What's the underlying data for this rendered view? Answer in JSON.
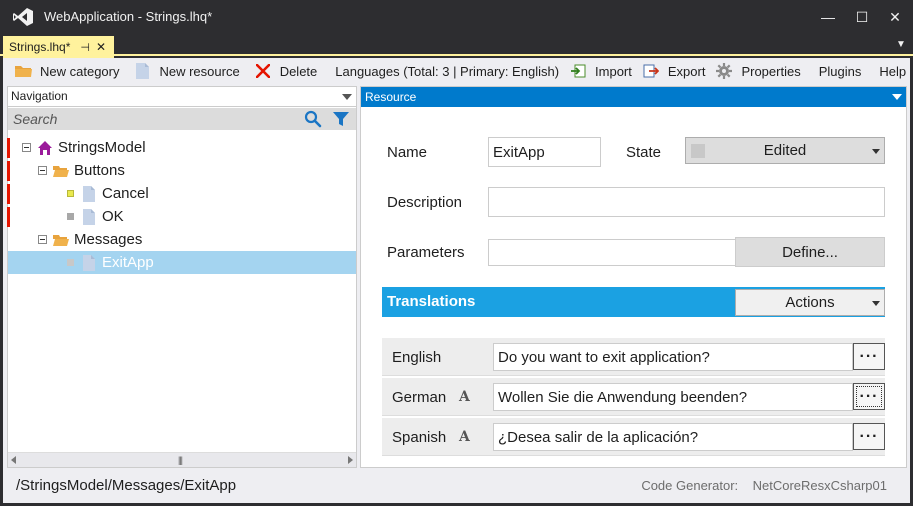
{
  "window": {
    "title": "WebApplication - Strings.lhq*",
    "minimize_glyph": "—",
    "maximize_glyph": "☐",
    "close_glyph": "✕"
  },
  "document_tab": {
    "label": "Strings.lhq*",
    "pin_glyph": "⊣",
    "close_glyph": "✕"
  },
  "toolbar": {
    "new_category": "New category",
    "new_resource": "New resource",
    "delete": "Delete",
    "languages": "Languages (Total: 3 | Primary: English)",
    "import": "Import",
    "export": "Export",
    "properties": "Properties",
    "plugins": "Plugins",
    "help": "Help"
  },
  "navigation": {
    "header": "Navigation",
    "search_placeholder": "Search",
    "tree": {
      "root": "StringsModel",
      "buttons": "Buttons",
      "cancel": "Cancel",
      "ok": "OK",
      "messages": "Messages",
      "exitapp": "ExitApp"
    }
  },
  "resource": {
    "header": "Resource",
    "name_label": "Name",
    "name_value": "ExitApp",
    "state_label": "State",
    "state_value": "Edited",
    "description_label": "Description",
    "description_value": "",
    "parameters_label": "Parameters",
    "parameters_value": "",
    "define_button": "Define...",
    "translations_label": "Translations",
    "actions_button": "Actions",
    "translations": [
      {
        "language": "English",
        "value": "Do you want to exit application?",
        "more": "···"
      },
      {
        "language": "German",
        "value": "Wollen Sie die Anwendung beenden?",
        "more": "···"
      },
      {
        "language": "Spanish",
        "value": "¿Desea salir de la aplicación?",
        "more": "···"
      }
    ],
    "auto_translate_glyph": "A"
  },
  "status": {
    "path": "/StringsModel/Messages/ExitApp",
    "code_generator": "Code Generator:    NetCoreResxCsharp01"
  },
  "colors": {
    "chrome": "#2d2d30",
    "tab_active": "#fff29d",
    "accent_blue": "#007acc",
    "translations_blue": "#1ba1e2",
    "selection": "#a4d4f0",
    "error_red": "#e51400",
    "state_new": "#e9e94e",
    "state_edited": "#a8a8a8"
  },
  "icons": {
    "app": "visual-studio-logo-icon",
    "new_category": "folder-icon",
    "new_resource": "document-icon",
    "delete": "red-x-icon",
    "import": "import-icon",
    "export": "export-icon",
    "properties": "gear-icon",
    "search": "magnifier-icon",
    "filter": "funnel-icon",
    "root": "house-icon"
  }
}
